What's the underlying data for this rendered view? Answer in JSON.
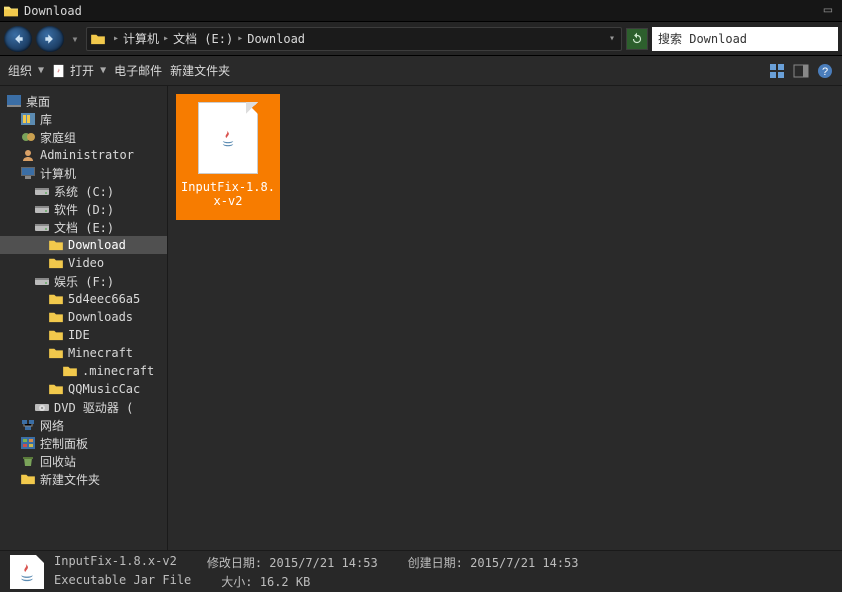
{
  "window": {
    "title": "Download"
  },
  "breadcrumbs": {
    "root_icon": "computer",
    "items": [
      "计算机",
      "文档 (E:)",
      "Download"
    ]
  },
  "search": {
    "text": "搜索 Download"
  },
  "toolbar": {
    "organize": "组织",
    "open": "打开",
    "email": "电子邮件",
    "new_folder": "新建文件夹"
  },
  "tree": [
    {
      "indent": 0,
      "icon": "desktop",
      "label": "桌面"
    },
    {
      "indent": 1,
      "icon": "library",
      "label": "库"
    },
    {
      "indent": 1,
      "icon": "homegroup",
      "label": "家庭组"
    },
    {
      "indent": 1,
      "icon": "user",
      "label": "Administrator"
    },
    {
      "indent": 1,
      "icon": "computer",
      "label": "计算机"
    },
    {
      "indent": 2,
      "icon": "drive",
      "label": "系统 (C:)"
    },
    {
      "indent": 2,
      "icon": "drive",
      "label": "软件 (D:)"
    },
    {
      "indent": 2,
      "icon": "drive",
      "label": "文档 (E:)"
    },
    {
      "indent": 3,
      "icon": "folder",
      "label": "Download",
      "selected": true
    },
    {
      "indent": 3,
      "icon": "folder",
      "label": "Video"
    },
    {
      "indent": 2,
      "icon": "drive",
      "label": "娱乐 (F:)"
    },
    {
      "indent": 3,
      "icon": "folder",
      "label": "5d4eec66a5"
    },
    {
      "indent": 3,
      "icon": "folder",
      "label": "Downloads"
    },
    {
      "indent": 3,
      "icon": "folder",
      "label": "IDE"
    },
    {
      "indent": 3,
      "icon": "folder",
      "label": "Minecraft"
    },
    {
      "indent": 4,
      "icon": "folder",
      "label": ".minecraft"
    },
    {
      "indent": 3,
      "icon": "folder",
      "label": "QQMusicCac"
    },
    {
      "indent": 2,
      "icon": "dvd",
      "label": "DVD 驱动器 ("
    },
    {
      "indent": 1,
      "icon": "network",
      "label": "网络"
    },
    {
      "indent": 1,
      "icon": "cpanel",
      "label": "控制面板"
    },
    {
      "indent": 1,
      "icon": "recycle",
      "label": "回收站"
    },
    {
      "indent": 1,
      "icon": "folder",
      "label": "新建文件夹"
    }
  ],
  "file": {
    "name_line1": "InputFix-1.8.",
    "name_line2": "x-v2"
  },
  "details": {
    "name": "InputFix-1.8.x-v2",
    "type": "Executable Jar File",
    "modified_label": "修改日期:",
    "modified": "2015/7/21 14:53",
    "created_label": "创建日期:",
    "created": "2015/7/21 14:53",
    "size_label": "大小:",
    "size": "16.2 KB"
  }
}
